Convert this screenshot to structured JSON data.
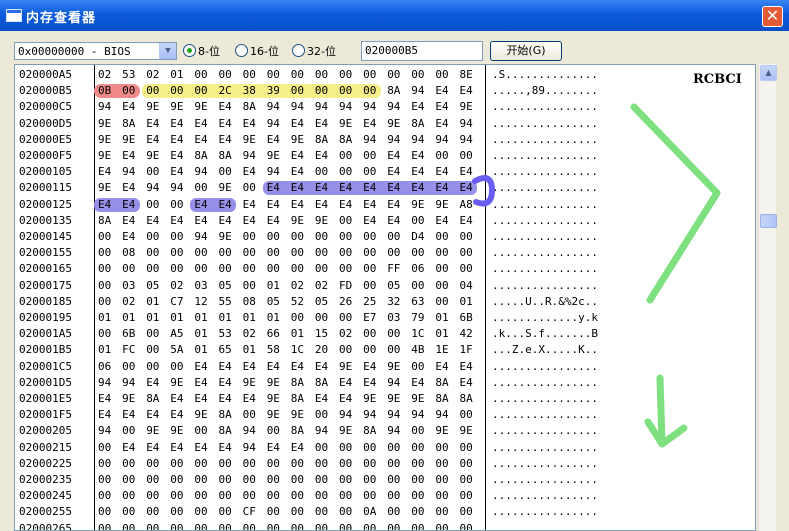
{
  "window": {
    "title": "内存查看器",
    "close_glyph": "✕"
  },
  "toolbar": {
    "range_select": "0x00000000 - BIOS",
    "radios": [
      {
        "label": "8-位",
        "checked": true
      },
      {
        "label": "16-位",
        "checked": false
      },
      {
        "label": "32-位",
        "checked": false
      }
    ],
    "address_value": "020000B5",
    "start_label": "开始(G)"
  },
  "watermark": "RCBCI",
  "rows": [
    {
      "addr": "020000A5",
      "bytes": [
        "02",
        "53",
        "02",
        "01",
        "00",
        "00",
        "00",
        "00",
        "00",
        "00",
        "00",
        "00",
        "00",
        "00",
        "00",
        "8E"
      ],
      "ascii": ".S.............."
    },
    {
      "addr": "020000B5",
      "bytes": [
        "0B",
        "00",
        "00",
        "00",
        "00",
        "2C",
        "38",
        "39",
        "00",
        "00",
        "00",
        "00",
        "8A",
        "94",
        "E4",
        "E4"
      ],
      "ascii": ".....,89........"
    },
    {
      "addr": "020000C5",
      "bytes": [
        "94",
        "E4",
        "9E",
        "9E",
        "9E",
        "E4",
        "8A",
        "94",
        "94",
        "94",
        "94",
        "94",
        "94",
        "E4",
        "E4",
        "9E"
      ],
      "ascii": "................"
    },
    {
      "addr": "020000D5",
      "bytes": [
        "9E",
        "8A",
        "E4",
        "E4",
        "E4",
        "E4",
        "E4",
        "94",
        "E4",
        "E4",
        "9E",
        "E4",
        "9E",
        "8A",
        "E4",
        "94"
      ],
      "ascii": "................"
    },
    {
      "addr": "020000E5",
      "bytes": [
        "9E",
        "9E",
        "E4",
        "E4",
        "E4",
        "E4",
        "9E",
        "E4",
        "9E",
        "8A",
        "8A",
        "94",
        "94",
        "94",
        "94",
        "94"
      ],
      "ascii": "................"
    },
    {
      "addr": "020000F5",
      "bytes": [
        "9E",
        "E4",
        "9E",
        "E4",
        "8A",
        "8A",
        "94",
        "9E",
        "E4",
        "E4",
        "00",
        "00",
        "E4",
        "E4",
        "00",
        "00"
      ],
      "ascii": "................"
    },
    {
      "addr": "02000105",
      "bytes": [
        "E4",
        "94",
        "00",
        "E4",
        "94",
        "00",
        "E4",
        "94",
        "E4",
        "00",
        "00",
        "00",
        "E4",
        "E4",
        "E4",
        "E4"
      ],
      "ascii": "................"
    },
    {
      "addr": "02000115",
      "bytes": [
        "9E",
        "E4",
        "94",
        "94",
        "00",
        "9E",
        "00",
        "E4",
        "E4",
        "E4",
        "E4",
        "E4",
        "E4",
        "E4",
        "E4",
        "E4"
      ],
      "ascii": "................"
    },
    {
      "addr": "02000125",
      "bytes": [
        "E4",
        "E4",
        "00",
        "00",
        "E4",
        "E4",
        "E4",
        "E4",
        "E4",
        "E4",
        "E4",
        "E4",
        "E4",
        "9E",
        "9E",
        "A8"
      ],
      "ascii": "................"
    },
    {
      "addr": "02000135",
      "bytes": [
        "8A",
        "E4",
        "E4",
        "E4",
        "E4",
        "E4",
        "E4",
        "E4",
        "9E",
        "9E",
        "00",
        "E4",
        "E4",
        "00",
        "E4",
        "E4"
      ],
      "ascii": "................"
    },
    {
      "addr": "02000145",
      "bytes": [
        "00",
        "E4",
        "00",
        "00",
        "94",
        "9E",
        "00",
        "00",
        "00",
        "00",
        "00",
        "00",
        "00",
        "D4",
        "00",
        "00"
      ],
      "ascii": "................"
    },
    {
      "addr": "02000155",
      "bytes": [
        "00",
        "08",
        "00",
        "00",
        "00",
        "00",
        "00",
        "00",
        "00",
        "00",
        "00",
        "00",
        "00",
        "00",
        "00",
        "00"
      ],
      "ascii": "................"
    },
    {
      "addr": "02000165",
      "bytes": [
        "00",
        "00",
        "00",
        "00",
        "00",
        "00",
        "00",
        "00",
        "00",
        "00",
        "00",
        "00",
        "FF",
        "06",
        "00",
        "00"
      ],
      "ascii": "................"
    },
    {
      "addr": "02000175",
      "bytes": [
        "00",
        "03",
        "05",
        "02",
        "03",
        "05",
        "00",
        "01",
        "02",
        "02",
        "FD",
        "00",
        "05",
        "00",
        "00",
        "04"
      ],
      "ascii": "................"
    },
    {
      "addr": "02000185",
      "bytes": [
        "00",
        "02",
        "01",
        "C7",
        "12",
        "55",
        "08",
        "05",
        "52",
        "05",
        "26",
        "25",
        "32",
        "63",
        "00",
        "01"
      ],
      "ascii": ".....U..R.&%2c.."
    },
    {
      "addr": "02000195",
      "bytes": [
        "01",
        "01",
        "01",
        "01",
        "01",
        "01",
        "01",
        "01",
        "00",
        "00",
        "00",
        "E7",
        "03",
        "79",
        "01",
        "6B"
      ],
      "ascii": ".............y.k"
    },
    {
      "addr": "020001A5",
      "bytes": [
        "00",
        "6B",
        "00",
        "A5",
        "01",
        "53",
        "02",
        "66",
        "01",
        "15",
        "02",
        "00",
        "00",
        "1C",
        "01",
        "42"
      ],
      "ascii": ".k...S.f.......B"
    },
    {
      "addr": "020001B5",
      "bytes": [
        "01",
        "FC",
        "00",
        "5A",
        "01",
        "65",
        "01",
        "58",
        "1C",
        "20",
        "00",
        "00",
        "00",
        "4B",
        "1E",
        "1F"
      ],
      "ascii": "...Z.e.X.....K.."
    },
    {
      "addr": "020001C5",
      "bytes": [
        "06",
        "00",
        "00",
        "00",
        "E4",
        "E4",
        "E4",
        "E4",
        "E4",
        "E4",
        "9E",
        "E4",
        "9E",
        "00",
        "E4",
        "E4"
      ],
      "ascii": "................"
    },
    {
      "addr": "020001D5",
      "bytes": [
        "94",
        "94",
        "E4",
        "9E",
        "E4",
        "E4",
        "9E",
        "9E",
        "8A",
        "8A",
        "E4",
        "E4",
        "94",
        "E4",
        "8A",
        "E4"
      ],
      "ascii": "................"
    },
    {
      "addr": "020001E5",
      "bytes": [
        "E4",
        "9E",
        "8A",
        "E4",
        "E4",
        "E4",
        "E4",
        "9E",
        "8A",
        "E4",
        "E4",
        "9E",
        "9E",
        "9E",
        "8A",
        "8A"
      ],
      "ascii": "................"
    },
    {
      "addr": "020001F5",
      "bytes": [
        "E4",
        "E4",
        "E4",
        "E4",
        "9E",
        "8A",
        "00",
        "9E",
        "9E",
        "00",
        "94",
        "94",
        "94",
        "94",
        "94",
        "00"
      ],
      "ascii": "................"
    },
    {
      "addr": "02000205",
      "bytes": [
        "94",
        "00",
        "9E",
        "9E",
        "00",
        "8A",
        "94",
        "00",
        "8A",
        "94",
        "9E",
        "8A",
        "94",
        "00",
        "9E",
        "9E"
      ],
      "ascii": "................"
    },
    {
      "addr": "02000215",
      "bytes": [
        "00",
        "E4",
        "E4",
        "E4",
        "E4",
        "E4",
        "94",
        "E4",
        "E4",
        "00",
        "00",
        "00",
        "00",
        "00",
        "00",
        "00"
      ],
      "ascii": "................"
    },
    {
      "addr": "02000225",
      "bytes": [
        "00",
        "00",
        "00",
        "00",
        "00",
        "00",
        "00",
        "00",
        "00",
        "00",
        "00",
        "00",
        "00",
        "00",
        "00",
        "00"
      ],
      "ascii": "................"
    },
    {
      "addr": "02000235",
      "bytes": [
        "00",
        "00",
        "00",
        "00",
        "00",
        "00",
        "00",
        "00",
        "00",
        "00",
        "00",
        "00",
        "00",
        "00",
        "00",
        "00"
      ],
      "ascii": "................"
    },
    {
      "addr": "02000245",
      "bytes": [
        "00",
        "00",
        "00",
        "00",
        "00",
        "00",
        "00",
        "00",
        "00",
        "00",
        "00",
        "00",
        "00",
        "00",
        "00",
        "00"
      ],
      "ascii": "................"
    },
    {
      "addr": "02000255",
      "bytes": [
        "00",
        "00",
        "00",
        "00",
        "00",
        "00",
        "CF",
        "00",
        "00",
        "00",
        "00",
        "0A",
        "00",
        "00",
        "00",
        "00"
      ],
      "ascii": "................"
    },
    {
      "addr": "02000265",
      "bytes": [
        "00",
        "00",
        "00",
        "00",
        "00",
        "00",
        "00",
        "00",
        "00",
        "00",
        "00",
        "00",
        "00",
        "00",
        "00",
        "00"
      ],
      "ascii": "................"
    }
  ],
  "colors": {
    "highlight_red": "#f08a8a",
    "highlight_yellow": "#f7ef8a",
    "highlight_blue": "#8c84e6",
    "annotation_green": "#7fe07f",
    "annotation_blue": "#6a5ef0"
  }
}
